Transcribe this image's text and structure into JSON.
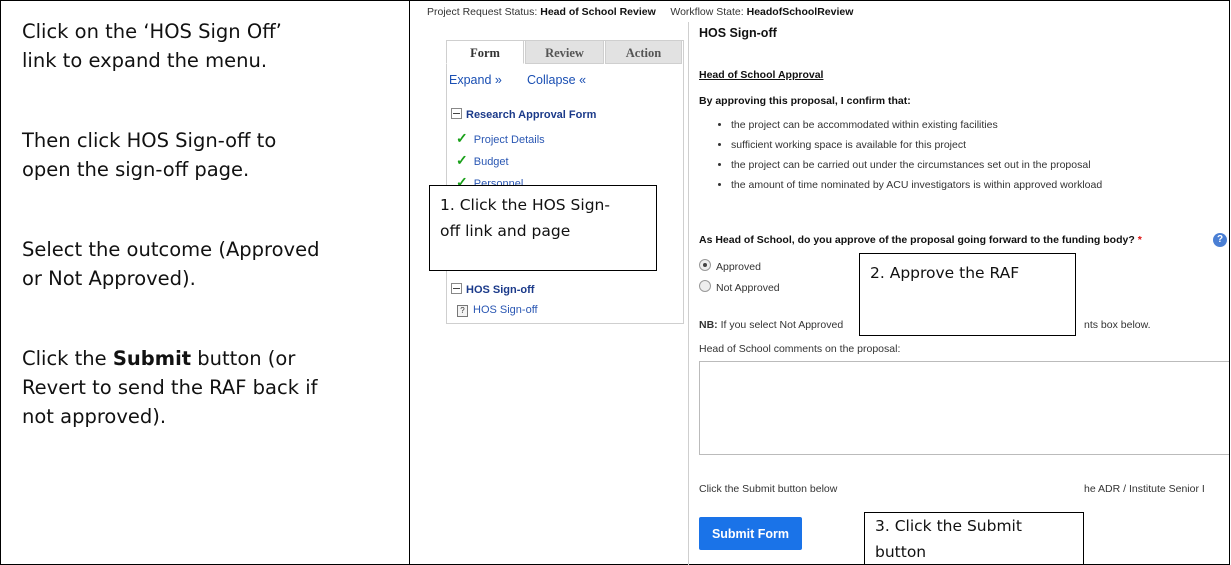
{
  "instructions": {
    "step1": [
      "Click on the ‘HOS Sign Off’",
      "link to expand the menu."
    ],
    "step2": [
      "Then click HOS Sign-off to",
      "open the sign-off page."
    ],
    "step3": [
      "Select the outcome (Approved",
      "or Not Approved)."
    ],
    "step4_prefix": "Click the ",
    "step4_bold": "Submit",
    "step4_suffix": " button (or",
    "step4_rest": [
      "Revert to send the RAF back if",
      "not approved)."
    ]
  },
  "status_bar": {
    "label": "Project Request Status:",
    "status": "Head of School Review",
    "workflow_label": "Workflow State:",
    "workflow_state": "HeadofSchoolReview"
  },
  "tabs": [
    "Form",
    "Review",
    "Action"
  ],
  "sidebar": {
    "expand": "Expand »",
    "collapse": "Collapse «",
    "folder1": "Research Approval Form",
    "items": [
      "Project Details",
      "Budget",
      "Personnel"
    ],
    "folder2": "HOS Sign-off",
    "sub_item": "HOS Sign-off"
  },
  "form": {
    "title": "HOS Sign-off",
    "subtitle": "Head of School Approval",
    "confirm_text": "By approving this proposal, I confirm that:",
    "bullets": [
      "the project can be accommodated within existing facilities",
      "sufficient working space is available for this project",
      "the project can be carried out under the circumstances set out in the proposal",
      "the amount of time nominated by ACU investigators is within approved workload"
    ],
    "question": "As Head of School, do you approve of the proposal going forward to the funding body?",
    "required_mark": "*",
    "options": [
      "Approved",
      "Not Approved"
    ],
    "selected": "Approved",
    "nb_label": "NB:",
    "nb_text": "If you select Not Approved",
    "nb_tail": "nts box below.",
    "comments_label": "Head of School comments on the proposal:",
    "submit_hint": "Click the Submit button below",
    "submit_hint_tail": "he ADR / Institute Senior I",
    "submit_label": "Submit Form"
  },
  "callouts": {
    "c1": [
      "1. Click the HOS Sign-",
      "off link and page"
    ],
    "c2": "2. Approve  the RAF",
    "c3": [
      "3. Click the Submit",
      "button"
    ]
  },
  "colors": {
    "link_blue": "#2a57b3",
    "submit_blue": "#1a73e8",
    "check_green": "#19a019",
    "required_red": "#d11"
  }
}
